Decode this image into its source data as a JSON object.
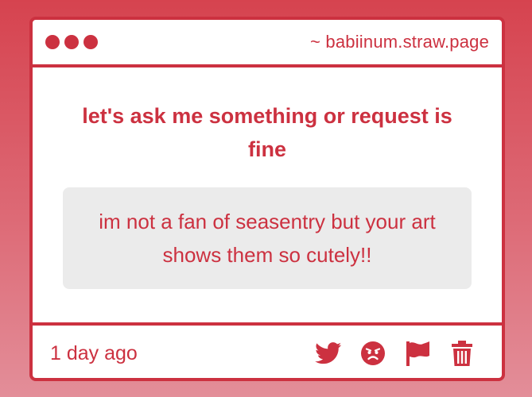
{
  "window": {
    "url": "~ babiinum.straw.page",
    "accent_color": "#cc3140"
  },
  "question": {
    "prompt": "let's ask me something or request is fine",
    "message": "im not a fan of seasentry but your art shows them so cutely!!"
  },
  "footer": {
    "timestamp": "1 day ago",
    "actions": [
      {
        "icon": "twitter-icon"
      },
      {
        "icon": "angry-face-icon"
      },
      {
        "icon": "flag-icon"
      },
      {
        "icon": "trash-icon"
      }
    ]
  }
}
